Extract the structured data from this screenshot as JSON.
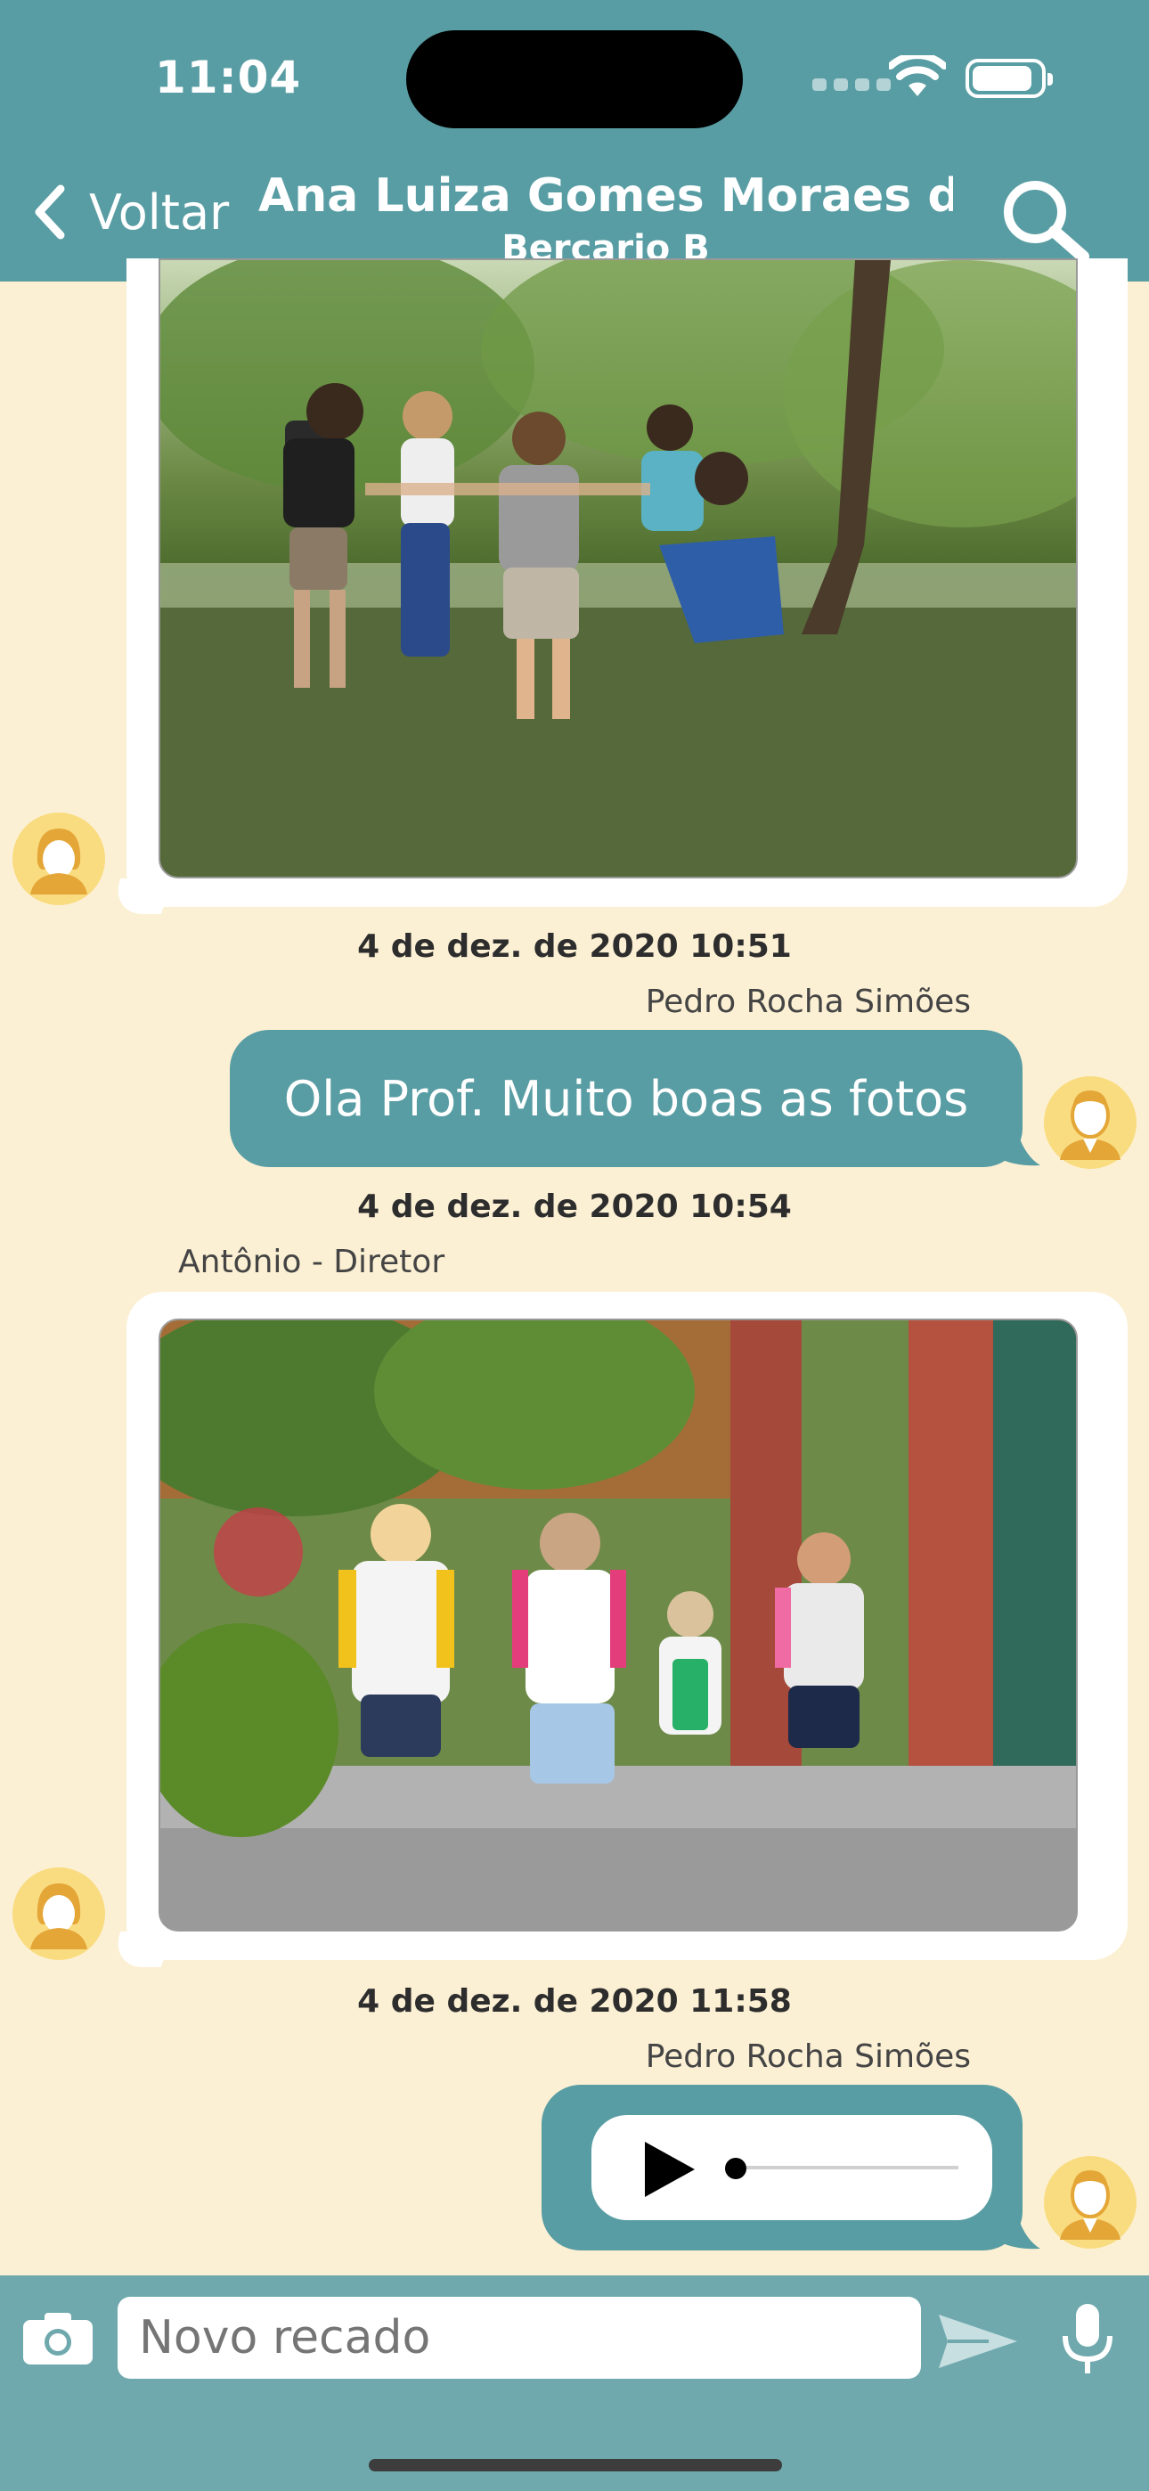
{
  "status_bar": {
    "time": "11:04"
  },
  "header": {
    "back_label": "Voltar",
    "title": "Ana Luiza Gomes Moraes d...",
    "subtitle": "Bercario B"
  },
  "messages": [
    {
      "type": "image",
      "side": "left",
      "photo": "children playing in a circle in a park"
    },
    {
      "type": "text",
      "side": "right",
      "timestamp": "4 de dez. de 2020 10:51",
      "sender": "Pedro Rocha Simões",
      "text": "Ola Prof. Muito boas as fotos"
    },
    {
      "type": "image",
      "side": "left",
      "timestamp": "4 de dez. de 2020 10:54",
      "sender": "Antônio - Diretor",
      "photo": "children with masks and backpacks running at school"
    },
    {
      "type": "audio",
      "side": "right",
      "timestamp": "4 de dez. de 2020 11:58",
      "sender": "Pedro Rocha Simões",
      "progress": 0
    }
  ],
  "composer": {
    "placeholder": "Novo recado"
  },
  "colors": {
    "header": "#589da3",
    "background": "#fcf0d4",
    "bubble_out": "#589da3",
    "bubble_in": "#ffffff",
    "avatar": "#f9dc80"
  },
  "icons": [
    "chevron-left-icon",
    "search-icon",
    "camera-icon",
    "send-icon",
    "microphone-icon",
    "play-icon",
    "female-avatar-icon",
    "male-avatar-icon"
  ]
}
